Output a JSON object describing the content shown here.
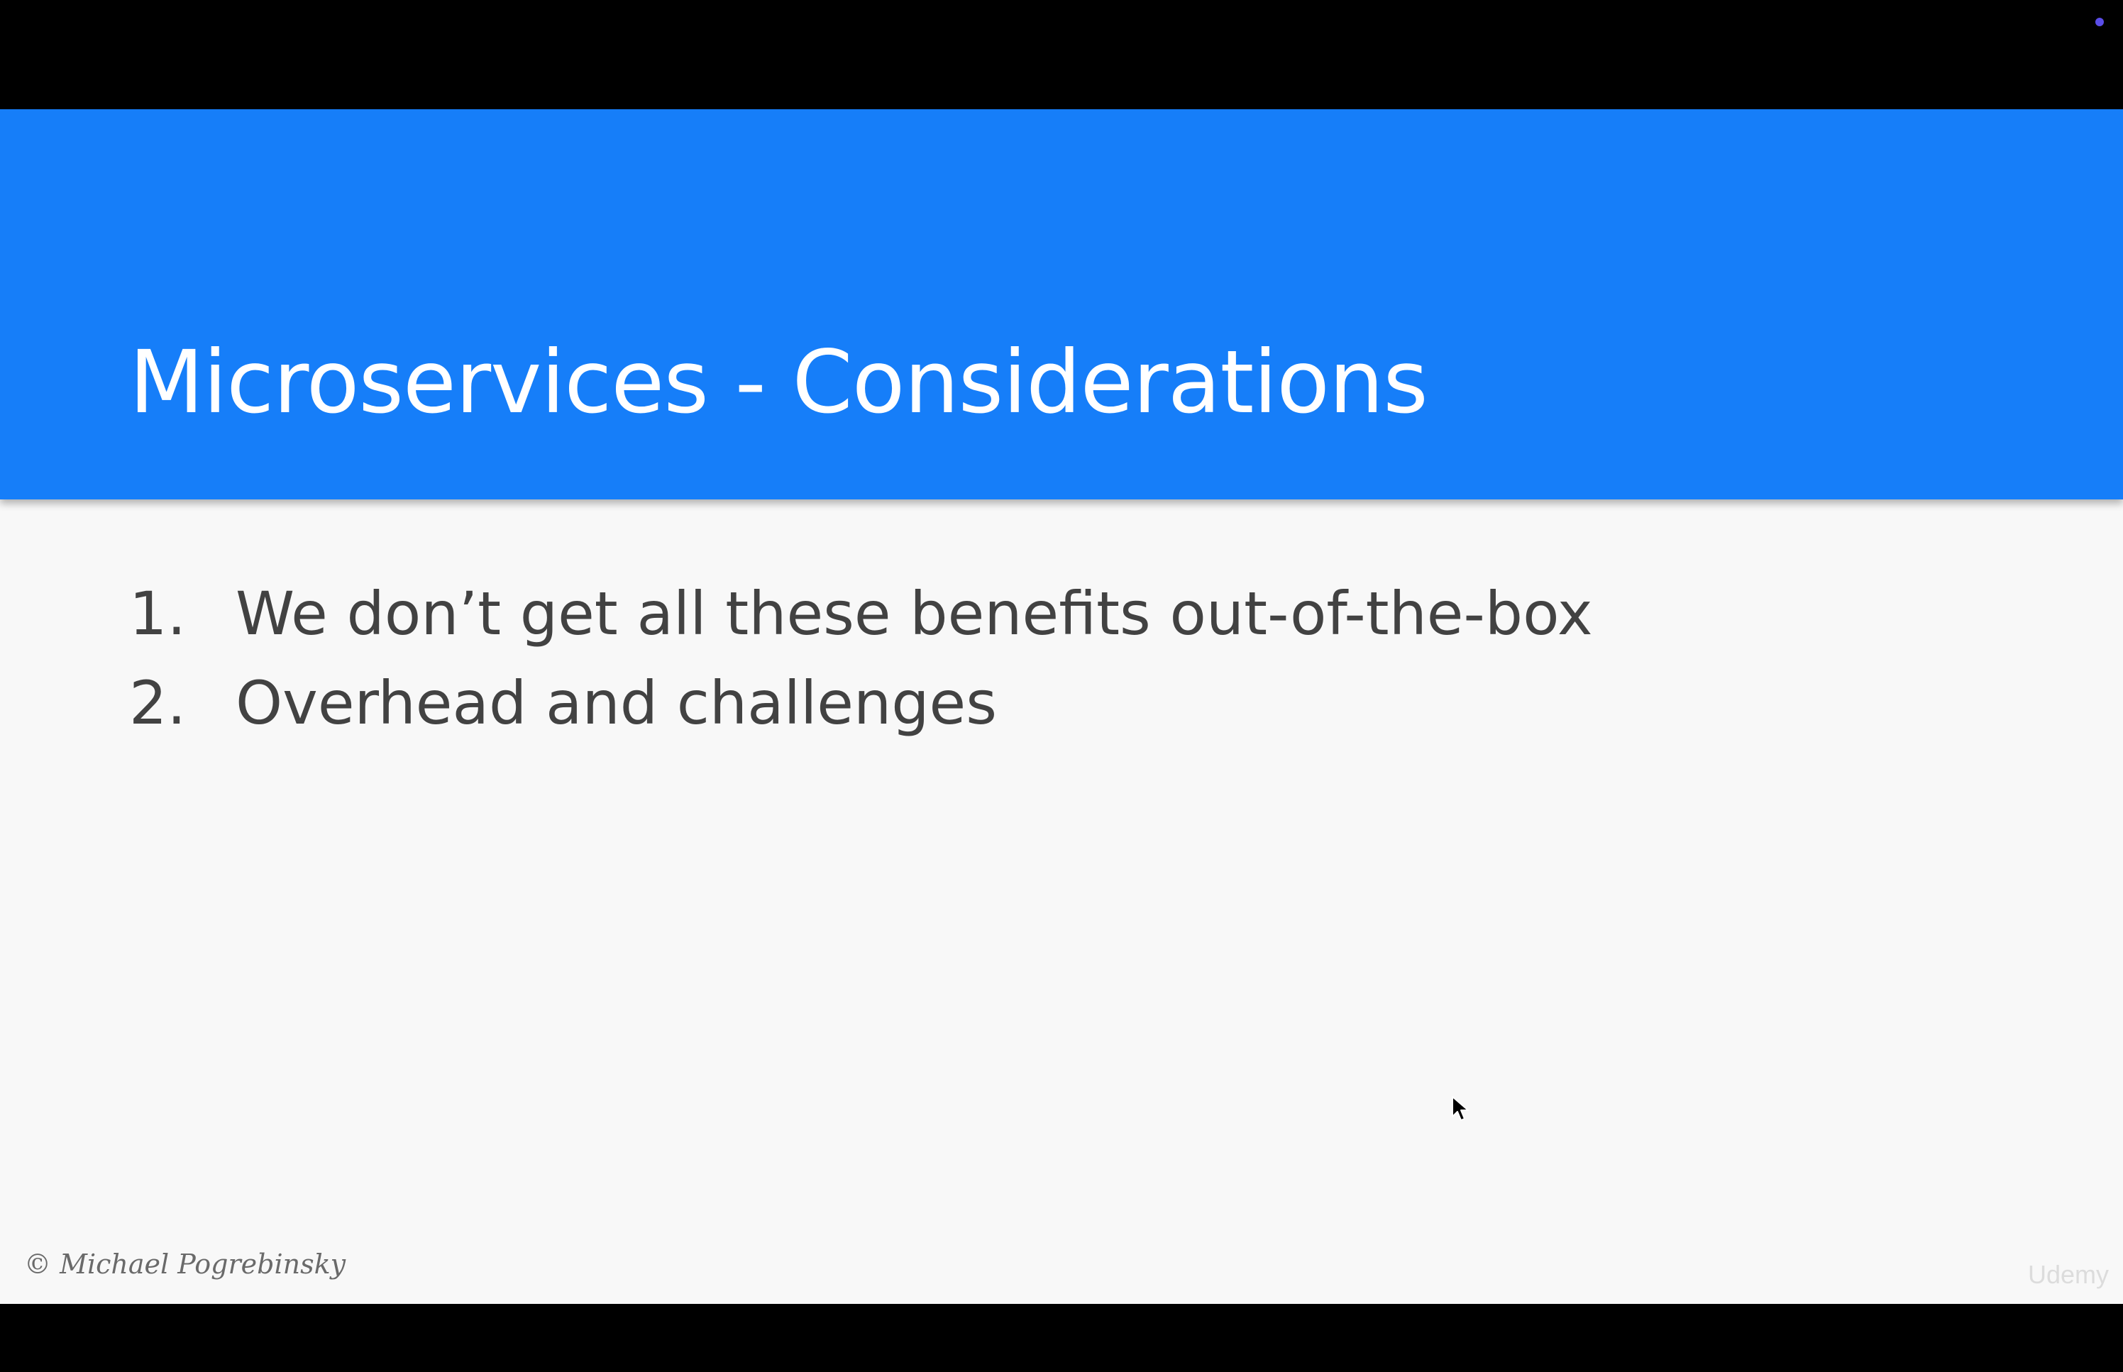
{
  "slide": {
    "title": "Microservices - Considerations",
    "header_color": "#167ef9",
    "background_color": "#f8f8f8",
    "items": [
      {
        "number": "1.",
        "text": "We don’t get all these benefits out-of-the-box"
      },
      {
        "number": "2.",
        "text": "Overhead and challenges"
      }
    ],
    "footer": {
      "author": "© Michael Pogrebinsky",
      "watermark": "Udemy"
    }
  },
  "cursor": {
    "icon": "mouse-pointer-icon"
  },
  "status_indicator": {
    "icon": "status-dot-icon",
    "color": "#5a4de8"
  }
}
